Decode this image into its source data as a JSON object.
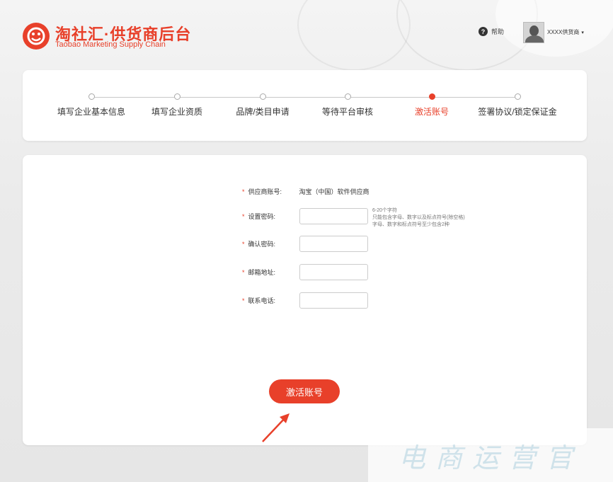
{
  "header": {
    "title": "淘社汇·供货商后台",
    "subtitle": "Taobao Marketing Supply Chain",
    "help_label": "帮助",
    "help_icon": "?",
    "user_name": "XXXX供货商",
    "user_caret": "▾"
  },
  "steps": [
    {
      "label": "填写企业基本信息",
      "active": false
    },
    {
      "label": "填写企业资质",
      "active": false
    },
    {
      "label": "品牌/类目申请",
      "active": false
    },
    {
      "label": "等待平台审核",
      "active": false
    },
    {
      "label": "激活账号",
      "active": true
    },
    {
      "label": "签署协议/锁定保证金",
      "active": false
    }
  ],
  "form": {
    "required_mark": "*",
    "account_label": "供应商账号:",
    "account_value": "淘宝（中国）软件供应商",
    "password_label": "设置密码:",
    "password_hint_1": "6-20个字符",
    "password_hint_2": "只能包含字母、数字以及标点符号(除空格)",
    "password_hint_3": "字母、数字和标点符号至少包含2种",
    "confirm_label": "确认密码:",
    "email_label": "邮箱地址:",
    "phone_label": "联系电话:",
    "submit_label": "激活账号"
  },
  "watermark": "电商运营官",
  "colors": {
    "accent": "#e8402a",
    "watermark": "#cfe2ea"
  }
}
